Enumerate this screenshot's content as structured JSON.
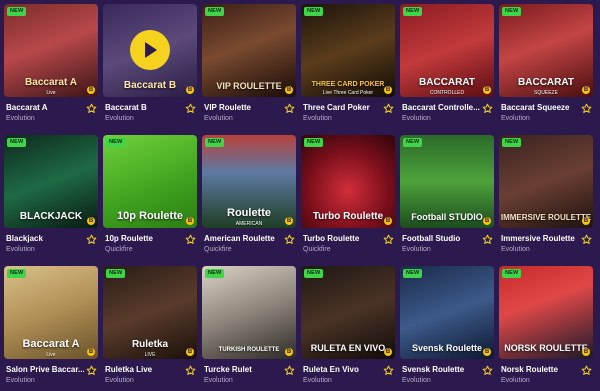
{
  "new_label": "NEW",
  "games": [
    {
      "name": "Baccarat A",
      "provider": "Evolution",
      "new": true,
      "caption": "Baccarat A",
      "sub": "Live",
      "bg": "linear-gradient(160deg,#7b2d2a 0%,#b8484a 45%,#3c1518 100%)",
      "capColor": "#ffe7a8",
      "capSize": 10
    },
    {
      "name": "Baccarat B",
      "provider": "Evolution",
      "new": false,
      "caption": "Baccarat B",
      "sub": "",
      "bg": "linear-gradient(160deg,#3a2a5c 0%,#5b4a7a 50%,#2a1d44 100%)",
      "capColor": "#ffe7a8",
      "capSize": 10,
      "play": true
    },
    {
      "name": "VIP Roulette",
      "provider": "Evolution",
      "new": true,
      "caption": "VIP ROULETTE",
      "sub": "",
      "bg": "linear-gradient(160deg,#3b1f17 0%,#7a4a30 45%,#1a0c08 100%)",
      "capColor": "#f4e3c0",
      "capSize": 9
    },
    {
      "name": "Three Card Poker",
      "provider": "Evolution",
      "new": true,
      "caption": "THREE CARD POKER",
      "sub": "Live Three Card Poker",
      "bg": "linear-gradient(160deg,#1c130b 0%,#5b3d1c 50%,#120b06 100%)",
      "capColor": "#f3c24a",
      "capSize": 7
    },
    {
      "name": "Baccarat Controlle...",
      "provider": "Evolution",
      "new": true,
      "caption": "BACCARAT",
      "sub": "CONTROLLED",
      "bg": "linear-gradient(160deg,#8a1c22 0%,#c23a3c 50%,#5a0d12 100%)",
      "capColor": "#ffffff",
      "capSize": 10
    },
    {
      "name": "Baccarat Squeeze",
      "provider": "Evolution",
      "new": true,
      "caption": "BACCARAT",
      "sub": "SQUEEZE",
      "bg": "linear-gradient(160deg,#7a1a1e 0%,#c44545 45%,#4a0e10 100%)",
      "capColor": "#ffffff",
      "capSize": 10
    },
    {
      "name": "Blackjack",
      "provider": "Evolution",
      "new": true,
      "caption": "BLACKJACK",
      "sub": "",
      "bg": "linear-gradient(160deg,#0e2a1e 0%,#1e6a44 50%,#0a1a12 100%)",
      "capColor": "#ffffff",
      "capSize": 10
    },
    {
      "name": "10p Roulette",
      "provider": "Quickfire",
      "new": true,
      "caption": "10p Roulette",
      "sub": "",
      "bg": "linear-gradient(160deg,#6fd13a 0%,#3ea11e 60%,#2c7d14 100%)",
      "capColor": "#ffffff",
      "capSize": 11
    },
    {
      "name": "American Roulette",
      "provider": "Quickfire",
      "new": true,
      "caption": "Roulette",
      "sub": "AMERICAN",
      "bg": "linear-gradient(180deg,#b7413b 0%,#5e7aa3 40%,#1e3e24 100%)",
      "capColor": "#ffffff",
      "capSize": 11
    },
    {
      "name": "Turbo Roulette",
      "provider": "Quickfire",
      "new": true,
      "caption": "Turbo Roulette",
      "sub": "",
      "bg": "radial-gradient(circle at 50% 60%,#d12e3a 0%,#7a0f1b 55%,#2d050a 100%)",
      "capColor": "#ffffff",
      "capSize": 10
    },
    {
      "name": "Football Studio",
      "provider": "Evolution",
      "new": true,
      "caption": "Football STUDIO",
      "sub": "",
      "bg": "linear-gradient(180deg,#2b6b2a 0%,#4ea23b 50%,#1c4d1e 100%)",
      "capColor": "#ffffff",
      "capSize": 9
    },
    {
      "name": "Immersive Roulette",
      "provider": "Evolution",
      "new": true,
      "caption": "IMMERSIVE ROULETTE",
      "sub": "",
      "bg": "linear-gradient(160deg,#3a2320 0%,#6a3f33 50%,#1f1210 100%)",
      "capColor": "#f3e1c4",
      "capSize": 8
    },
    {
      "name": "Salon Prive Baccar...",
      "provider": "Evolution",
      "new": true,
      "caption": "Baccarat A",
      "sub": "Live",
      "bg": "linear-gradient(160deg,#d9c08a 0%,#b08f55 50%,#6a522a 100%)",
      "capColor": "#ffffff",
      "capSize": 11
    },
    {
      "name": "Ruletka Live",
      "provider": "Evolution",
      "new": true,
      "caption": "Ruletka",
      "sub": "LIVE",
      "bg": "linear-gradient(160deg,#2a1d17 0%,#5a3b2c 50%,#1a100b 100%)",
      "capColor": "#ffffff",
      "capSize": 10
    },
    {
      "name": "Turcke Rulet",
      "provider": "Evolution",
      "new": true,
      "caption": "TURKISH ROULETTE",
      "sub": "",
      "bg": "linear-gradient(160deg,#d9d2c6 0%,#8d857a 50%,#2d2a26 100%)",
      "capColor": "#ffffff",
      "capSize": 6
    },
    {
      "name": "Ruleta En Vivo",
      "provider": "Evolution",
      "new": true,
      "caption": "RULETA EN VIVO",
      "sub": "",
      "bg": "linear-gradient(160deg,#1f1713 0%,#4a3326 50%,#120c09 100%)",
      "capColor": "#ffffff",
      "capSize": 9
    },
    {
      "name": "Svensk Roulette",
      "provider": "Evolution",
      "new": true,
      "caption": "Svensk Roulette",
      "sub": "",
      "bg": "linear-gradient(160deg,#1a2a4a 0%,#3c5a8a 50%,#0d1830 100%)",
      "capColor": "#ffffff",
      "capSize": 9
    },
    {
      "name": "Norsk Roulette",
      "provider": "Evolution",
      "new": true,
      "caption": "NORSK ROULETTE",
      "sub": "",
      "bg": "linear-gradient(160deg,#c62a2a 0%,#e04848 40%,#1a1a2a 100%)",
      "capColor": "#ffffff",
      "capSize": 9
    }
  ],
  "colors": {
    "accent": "#f5d21e",
    "new_badge": "#3fd44a",
    "provider": "#b7aac9",
    "background": "#2c1a4e"
  }
}
